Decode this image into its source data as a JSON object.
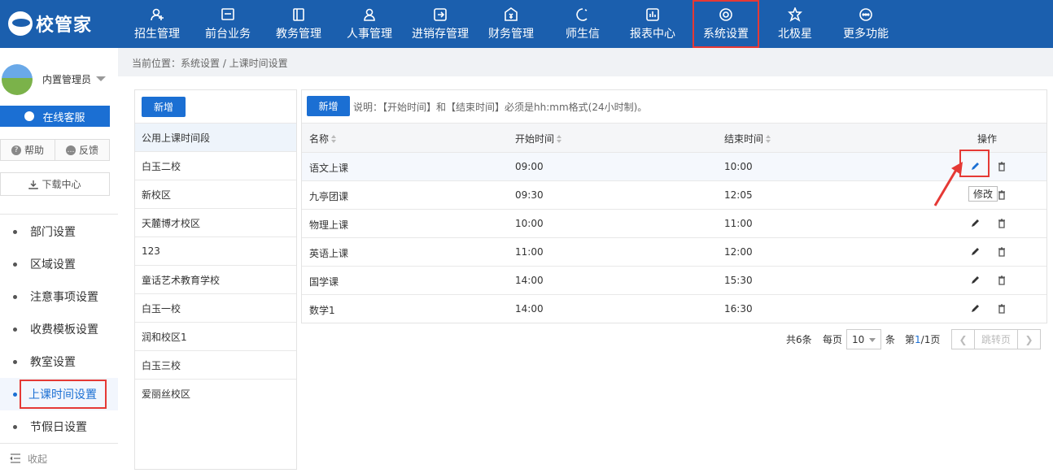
{
  "brand": {
    "name": "校管家"
  },
  "nav": [
    {
      "label": "招生管理",
      "icon": "user-plus-icon"
    },
    {
      "label": "前台业务",
      "icon": "monitor-icon"
    },
    {
      "label": "教务管理",
      "icon": "book-icon"
    },
    {
      "label": "人事管理",
      "icon": "person-icon"
    },
    {
      "label": "进销存管理",
      "icon": "inventory-icon"
    },
    {
      "label": "财务管理",
      "icon": "finance-icon"
    },
    {
      "label": "师生信",
      "icon": "message-icon"
    },
    {
      "label": "报表中心",
      "icon": "report-icon"
    },
    {
      "label": "系统设置",
      "icon": "settings-icon",
      "active": true
    },
    {
      "label": "北极星",
      "icon": "star-icon"
    },
    {
      "label": "更多功能",
      "icon": "more-icon"
    }
  ],
  "user": {
    "name": "内置管理员"
  },
  "sidebar": {
    "service_label": "在线客服",
    "help_label": "帮助",
    "feedback_label": "反馈",
    "download_label": "下载中心",
    "items": [
      {
        "label": "部门设置"
      },
      {
        "label": "区域设置"
      },
      {
        "label": "注意事项设置"
      },
      {
        "label": "收费模板设置"
      },
      {
        "label": "教室设置"
      },
      {
        "label": "上课时间设置",
        "active": true
      },
      {
        "label": "节假日设置"
      }
    ],
    "collapse_label": "收起"
  },
  "breadcrumb": "当前位置：系统设置 / 上课时间设置",
  "left_panel": {
    "add_label": "新增",
    "items": [
      "公用上课时间段",
      "白玉二校",
      "新校区",
      "天麓博才校区",
      "123",
      "童话艺术教育学校",
      "白玉一校",
      "润和校区1",
      "白玉三校",
      "爱丽丝校区"
    ]
  },
  "right_panel": {
    "add_label": "新增",
    "note": "说明：【开始时间】和【结束时间】必须是hh:mm格式(24小时制)。",
    "columns": {
      "name": "名称",
      "start": "开始时间",
      "end": "结束时间",
      "ops": "操作"
    },
    "rows": [
      {
        "name": "语文上课",
        "start": "09:00",
        "end": "10:00"
      },
      {
        "name": "九亭团课",
        "start": "09:30",
        "end": "12:05"
      },
      {
        "name": "物理上课",
        "start": "10:00",
        "end": "11:00"
      },
      {
        "name": "英语上课",
        "start": "11:00",
        "end": "12:00"
      },
      {
        "name": "国学课",
        "start": "14:00",
        "end": "15:30"
      },
      {
        "name": "数学1",
        "start": "14:00",
        "end": "16:30"
      }
    ],
    "tooltip": "修改"
  },
  "pagination": {
    "total": "共6条",
    "per_page_label": "每页",
    "per_page": "10",
    "unit": "条",
    "page_prefix": "第",
    "current": "1",
    "page_suffix": "/1页",
    "jump_label": "跳转页"
  },
  "colors": {
    "header": "#1b5fae",
    "accent": "#1b6fd3",
    "highlight": "#e53935"
  }
}
